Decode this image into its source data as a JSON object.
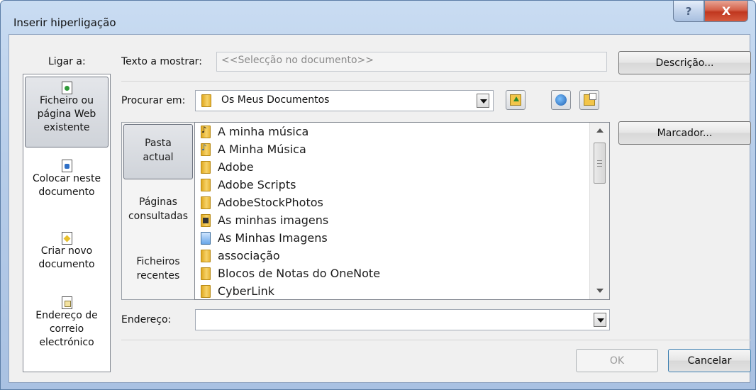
{
  "window": {
    "title": "Inserir hiperligação"
  },
  "titlebar": {
    "help_glyph": "?",
    "close_glyph": "X"
  },
  "link_to": {
    "label": "Ligar a:",
    "items": [
      {
        "label_line1": "Ficheiro ou",
        "label_line2": "página Web",
        "label_line3": "existente",
        "icon": "existing-file-icon"
      },
      {
        "label_line1": "Colocar neste",
        "label_line2": "documento",
        "icon": "place-in-document-icon"
      },
      {
        "label_line1": "Criar novo",
        "label_line2": "documento",
        "icon": "new-document-icon"
      },
      {
        "label_line1": "Endereço de",
        "label_line2": "correio",
        "label_line3": "electrónico",
        "icon": "email-address-icon"
      }
    ]
  },
  "text_to_display": {
    "label": "Texto a mostrar:",
    "value": "<<Selecção no documento>>"
  },
  "screentip_button": "Descrição...",
  "look_in": {
    "label": "Procurar em:",
    "value": "Os Meus Documentos"
  },
  "bookmark_button": "Marcador...",
  "nav": [
    {
      "line1": "Pasta",
      "line2": "actual"
    },
    {
      "line1": "Páginas",
      "line2": "consultadas"
    },
    {
      "line1": "Ficheiros",
      "line2": "recentes"
    }
  ],
  "files": [
    {
      "name": "A minha música",
      "icon": "music-folder-icon"
    },
    {
      "name": "A Minha Música",
      "icon": "music-folder-icon"
    },
    {
      "name": "Adobe",
      "icon": "folder-icon"
    },
    {
      "name": "Adobe Scripts",
      "icon": "folder-icon"
    },
    {
      "name": "AdobeStockPhotos",
      "icon": "folder-icon"
    },
    {
      "name": "As minhas imagens",
      "icon": "pictures-folder-icon"
    },
    {
      "name": "As Minhas Imagens",
      "icon": "pictures-folder-icon"
    },
    {
      "name": "associação",
      "icon": "folder-icon"
    },
    {
      "name": "Blocos de Notas do OneNote",
      "icon": "folder-icon"
    },
    {
      "name": "CyberLink",
      "icon": "folder-icon"
    }
  ],
  "address": {
    "label": "Endereço:",
    "value": ""
  },
  "ok_button": "OK",
  "cancel_button": "Cancelar"
}
